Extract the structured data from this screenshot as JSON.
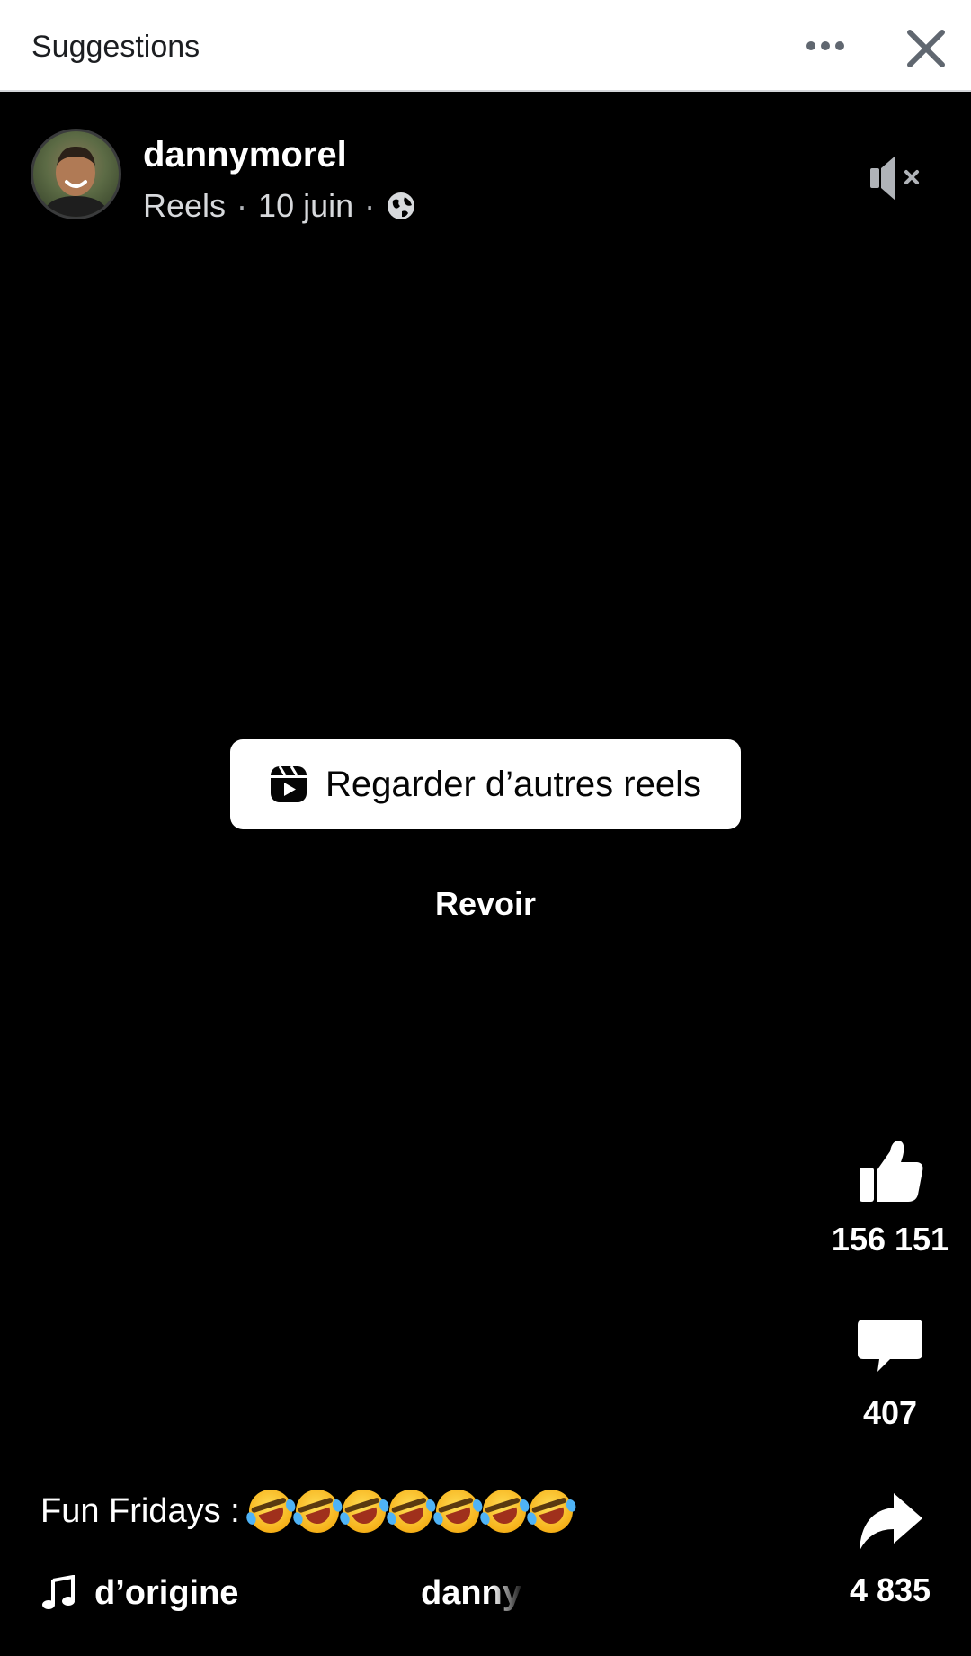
{
  "topbar": {
    "title": "Suggestions",
    "more_icon": "more-horizontal-icon",
    "close_icon": "close-icon"
  },
  "post": {
    "author": "dannymorel",
    "meta_type": "Reels",
    "meta_sep": "·",
    "meta_date": "10 juin",
    "audience_icon": "globe-icon",
    "mute_icon": "speaker-muted-icon"
  },
  "overlay": {
    "watch_more_label": "Regarder d’autres reels",
    "watch_more_icon": "reels-icon",
    "replay_label": "Revoir"
  },
  "actions": {
    "likes": "156 151",
    "comments": "407",
    "shares": "4 835"
  },
  "caption": {
    "text": "Fun Fridays :",
    "emoji_count": 7,
    "emoji_name": "rolling-on-the-floor-laughing"
  },
  "audio": {
    "text_left": "d’origine",
    "text_right": "danny"
  },
  "colors": {
    "background": "#000000",
    "topbar_bg": "#ffffff",
    "text_primary": "#ffffff",
    "icon_gray": "#606770"
  }
}
